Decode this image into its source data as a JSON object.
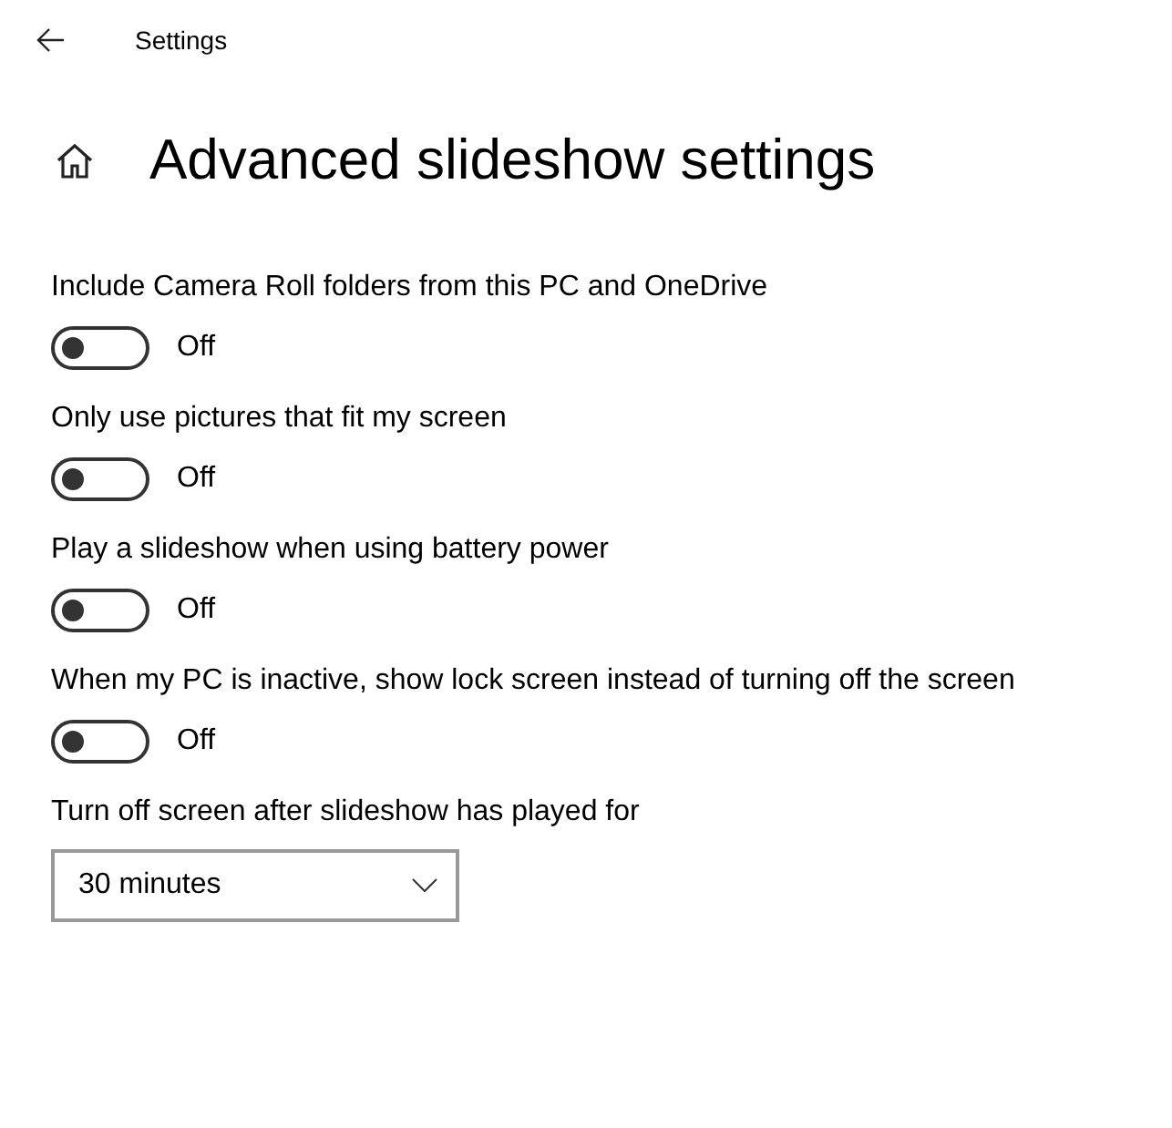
{
  "header": {
    "title": "Settings"
  },
  "page": {
    "title": "Advanced slideshow settings"
  },
  "toggles": [
    {
      "label": "Include Camera Roll folders from this PC and OneDrive",
      "on": false,
      "state_text": "Off"
    },
    {
      "label": "Only use pictures that fit my screen",
      "on": false,
      "state_text": "Off"
    },
    {
      "label": "Play a slideshow when using battery power",
      "on": false,
      "state_text": "Off"
    },
    {
      "label": "When my PC is inactive, show lock screen instead of turning off the screen",
      "on": false,
      "state_text": "Off"
    }
  ],
  "dropdown": {
    "label": "Turn off screen after slideshow has played for",
    "value": "30 minutes"
  }
}
